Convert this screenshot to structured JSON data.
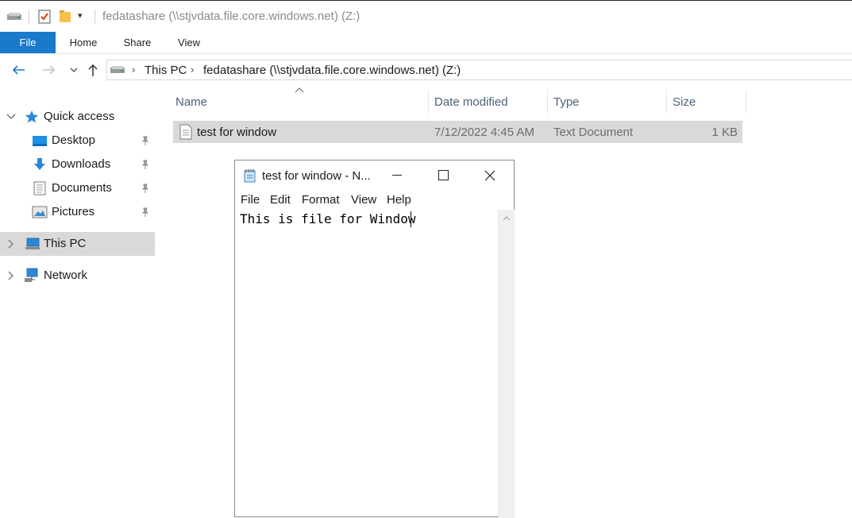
{
  "window": {
    "title": "fedatashare (\\\\stjvdata.file.core.windows.net) (Z:)"
  },
  "ribbon": {
    "tabs": [
      "File",
      "Home",
      "Share",
      "View"
    ]
  },
  "address": {
    "crumbs": [
      "This PC",
      "fedatashare (\\\\stjvdata.file.core.windows.net) (Z:)"
    ]
  },
  "sidebar": {
    "items": [
      {
        "label": "Quick access",
        "icon": "star-icon"
      },
      {
        "label": "Desktop",
        "icon": "desktop-folder-icon"
      },
      {
        "label": "Downloads",
        "icon": "downloads-folder-icon"
      },
      {
        "label": "Documents",
        "icon": "documents-folder-icon"
      },
      {
        "label": "Pictures",
        "icon": "pictures-folder-icon"
      },
      {
        "label": "This PC",
        "icon": "computer-icon"
      },
      {
        "label": "Network",
        "icon": "network-icon"
      }
    ]
  },
  "columns": [
    "Name",
    "Date modified",
    "Type",
    "Size"
  ],
  "files": [
    {
      "name": "test for window",
      "modified": "7/12/2022 4:45 AM",
      "type": "Text Document",
      "size": "1 KB"
    }
  ],
  "notepad": {
    "title": "test for window - N...",
    "menu": [
      "File",
      "Edit",
      "Format",
      "View",
      "Help"
    ],
    "content": "This is file for Window"
  },
  "colors": {
    "accent": "#1979ca",
    "selection": "#d9d9d9",
    "header_text": "#4c607a"
  }
}
